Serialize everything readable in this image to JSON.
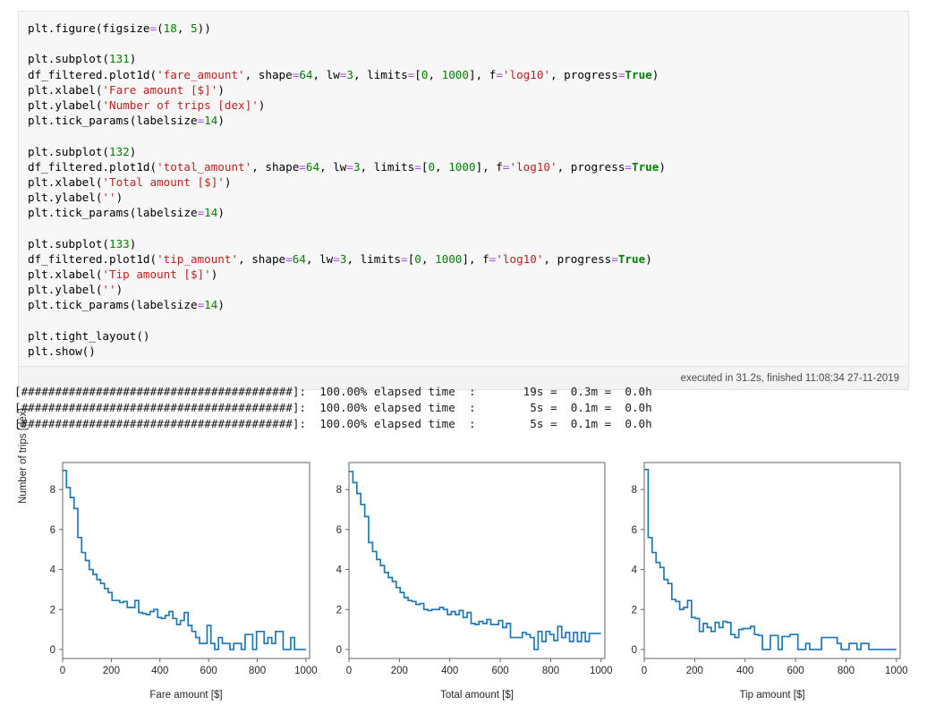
{
  "notebook": {
    "code_lines": [
      [
        {
          "t": "plain",
          "v": "plt.figure(figsize"
        },
        {
          "t": "op",
          "v": "="
        },
        {
          "t": "plain",
          "v": "("
        },
        {
          "t": "num",
          "v": "18"
        },
        {
          "t": "plain",
          "v": ", "
        },
        {
          "t": "num",
          "v": "5"
        },
        {
          "t": "plain",
          "v": "))"
        }
      ],
      [],
      [
        {
          "t": "plain",
          "v": "plt.subplot("
        },
        {
          "t": "num",
          "v": "131"
        },
        {
          "t": "plain",
          "v": ")"
        }
      ],
      [
        {
          "t": "plain",
          "v": "df_filtered.plot1d("
        },
        {
          "t": "str",
          "v": "'fare_amount'"
        },
        {
          "t": "plain",
          "v": ", shape"
        },
        {
          "t": "op",
          "v": "="
        },
        {
          "t": "num",
          "v": "64"
        },
        {
          "t": "plain",
          "v": ", lw"
        },
        {
          "t": "op",
          "v": "="
        },
        {
          "t": "num",
          "v": "3"
        },
        {
          "t": "plain",
          "v": ", limits"
        },
        {
          "t": "op",
          "v": "="
        },
        {
          "t": "plain",
          "v": "["
        },
        {
          "t": "num",
          "v": "0"
        },
        {
          "t": "plain",
          "v": ", "
        },
        {
          "t": "num",
          "v": "1000"
        },
        {
          "t": "plain",
          "v": "], f"
        },
        {
          "t": "op",
          "v": "="
        },
        {
          "t": "str",
          "v": "'log10'"
        },
        {
          "t": "plain",
          "v": ", progress"
        },
        {
          "t": "op",
          "v": "="
        },
        {
          "t": "kw",
          "v": "True"
        },
        {
          "t": "plain",
          "v": ")"
        }
      ],
      [
        {
          "t": "plain",
          "v": "plt.xlabel("
        },
        {
          "t": "str",
          "v": "'Fare amount [$]'"
        },
        {
          "t": "plain",
          "v": ")"
        }
      ],
      [
        {
          "t": "plain",
          "v": "plt.ylabel("
        },
        {
          "t": "str",
          "v": "'Number of trips [dex]'"
        },
        {
          "t": "plain",
          "v": ")"
        }
      ],
      [
        {
          "t": "plain",
          "v": "plt.tick_params(labelsize"
        },
        {
          "t": "op",
          "v": "="
        },
        {
          "t": "num",
          "v": "14"
        },
        {
          "t": "plain",
          "v": ")"
        }
      ],
      [],
      [
        {
          "t": "plain",
          "v": "plt.subplot("
        },
        {
          "t": "num",
          "v": "132"
        },
        {
          "t": "plain",
          "v": ")"
        }
      ],
      [
        {
          "t": "plain",
          "v": "df_filtered.plot1d("
        },
        {
          "t": "str",
          "v": "'total_amount'"
        },
        {
          "t": "plain",
          "v": ", shape"
        },
        {
          "t": "op",
          "v": "="
        },
        {
          "t": "num",
          "v": "64"
        },
        {
          "t": "plain",
          "v": ", lw"
        },
        {
          "t": "op",
          "v": "="
        },
        {
          "t": "num",
          "v": "3"
        },
        {
          "t": "plain",
          "v": ", limits"
        },
        {
          "t": "op",
          "v": "="
        },
        {
          "t": "plain",
          "v": "["
        },
        {
          "t": "num",
          "v": "0"
        },
        {
          "t": "plain",
          "v": ", "
        },
        {
          "t": "num",
          "v": "1000"
        },
        {
          "t": "plain",
          "v": "], f"
        },
        {
          "t": "op",
          "v": "="
        },
        {
          "t": "str",
          "v": "'log10'"
        },
        {
          "t": "plain",
          "v": ", progress"
        },
        {
          "t": "op",
          "v": "="
        },
        {
          "t": "kw",
          "v": "True"
        },
        {
          "t": "plain",
          "v": ")"
        }
      ],
      [
        {
          "t": "plain",
          "v": "plt.xlabel("
        },
        {
          "t": "str",
          "v": "'Total amount [$]'"
        },
        {
          "t": "plain",
          "v": ")"
        }
      ],
      [
        {
          "t": "plain",
          "v": "plt.ylabel("
        },
        {
          "t": "str",
          "v": "''"
        },
        {
          "t": "plain",
          "v": ")"
        }
      ],
      [
        {
          "t": "plain",
          "v": "plt.tick_params(labelsize"
        },
        {
          "t": "op",
          "v": "="
        },
        {
          "t": "num",
          "v": "14"
        },
        {
          "t": "plain",
          "v": ")"
        }
      ],
      [],
      [
        {
          "t": "plain",
          "v": "plt.subplot("
        },
        {
          "t": "num",
          "v": "133"
        },
        {
          "t": "plain",
          "v": ")"
        }
      ],
      [
        {
          "t": "plain",
          "v": "df_filtered.plot1d("
        },
        {
          "t": "str",
          "v": "'tip_amount'"
        },
        {
          "t": "plain",
          "v": ", shape"
        },
        {
          "t": "op",
          "v": "="
        },
        {
          "t": "num",
          "v": "64"
        },
        {
          "t": "plain",
          "v": ", lw"
        },
        {
          "t": "op",
          "v": "="
        },
        {
          "t": "num",
          "v": "3"
        },
        {
          "t": "plain",
          "v": ", limits"
        },
        {
          "t": "op",
          "v": "="
        },
        {
          "t": "plain",
          "v": "["
        },
        {
          "t": "num",
          "v": "0"
        },
        {
          "t": "plain",
          "v": ", "
        },
        {
          "t": "num",
          "v": "1000"
        },
        {
          "t": "plain",
          "v": "], f"
        },
        {
          "t": "op",
          "v": "="
        },
        {
          "t": "str",
          "v": "'log10'"
        },
        {
          "t": "plain",
          "v": ", progress"
        },
        {
          "t": "op",
          "v": "="
        },
        {
          "t": "kw",
          "v": "True"
        },
        {
          "t": "plain",
          "v": ")"
        }
      ],
      [
        {
          "t": "plain",
          "v": "plt.xlabel("
        },
        {
          "t": "str",
          "v": "'Tip amount [$]'"
        },
        {
          "t": "plain",
          "v": ")"
        }
      ],
      [
        {
          "t": "plain",
          "v": "plt.ylabel("
        },
        {
          "t": "str",
          "v": "''"
        },
        {
          "t": "plain",
          "v": ")"
        }
      ],
      [
        {
          "t": "plain",
          "v": "plt.tick_params(labelsize"
        },
        {
          "t": "op",
          "v": "="
        },
        {
          "t": "num",
          "v": "14"
        },
        {
          "t": "plain",
          "v": ")"
        }
      ],
      [],
      [
        {
          "t": "plain",
          "v": "plt.tight_layout()"
        }
      ],
      [
        {
          "t": "plain",
          "v": "plt.show()"
        }
      ]
    ],
    "execution_status": "executed in 31.2s, finished 11:08:34 27-11-2019"
  },
  "progress_output": {
    "lines": [
      "[########################################]:  100.00% elapsed time  :       19s =  0.3m =  0.0h",
      "[########################################]:  100.00% elapsed time  :        5s =  0.1m =  0.0h",
      "[########################################]:  100.00% elapsed time  :        5s =  0.1m =  0.0h"
    ]
  },
  "chart_data": [
    {
      "type": "line",
      "drawstyle": "steps-post",
      "title": "",
      "xlabel": "Fare amount [$]",
      "ylabel": "Number of trips [dex]",
      "xlim": [
        0,
        1015
      ],
      "ylim": [
        -0.45,
        9.35
      ],
      "xticks": [
        0,
        200,
        400,
        600,
        800,
        1000
      ],
      "yticks": [
        0,
        2,
        4,
        6,
        8
      ],
      "grid": false,
      "legend": null,
      "line_color": "#1f77b4",
      "bin_width": 15.625,
      "x": [
        0,
        15.6,
        31.3,
        46.9,
        62.5,
        78.1,
        93.8,
        109.4,
        125,
        140.6,
        156.3,
        171.9,
        187.5,
        203.1,
        218.8,
        234.4,
        250,
        265.6,
        281.3,
        296.9,
        312.5,
        328.1,
        343.8,
        359.4,
        375,
        390.6,
        406.3,
        421.9,
        437.5,
        453.1,
        468.8,
        484.4,
        500,
        515.6,
        531.3,
        546.9,
        562.5,
        578.1,
        593.8,
        609.4,
        625,
        640.6,
        656.3,
        671.9,
        687.5,
        703.1,
        718.8,
        734.4,
        750,
        765.6,
        781.3,
        796.9,
        812.5,
        828.1,
        843.8,
        859.4,
        875,
        890.6,
        906.3,
        921.9,
        937.5,
        953.1,
        968.8,
        984.4
      ],
      "values": [
        8.95,
        8.1,
        7.6,
        7.05,
        5.6,
        4.85,
        4.45,
        4.0,
        3.75,
        3.5,
        3.3,
        3.05,
        2.85,
        2.45,
        2.45,
        2.35,
        2.4,
        2.1,
        2.1,
        2.45,
        1.85,
        1.8,
        1.75,
        1.9,
        2.0,
        1.6,
        1.55,
        1.7,
        1.9,
        1.55,
        1.25,
        1.45,
        1.85,
        1.2,
        0.9,
        0.6,
        0.3,
        0.3,
        1.2,
        0.3,
        0.0,
        0.6,
        0.3,
        0.3,
        0.0,
        0.3,
        0.3,
        0.0,
        0.75,
        0.75,
        0.0,
        0.9,
        0.9,
        0.3,
        0.6,
        0.3,
        0.9,
        0.9,
        0.0,
        0.0,
        0.6,
        0.0,
        0.0,
        0.0
      ]
    },
    {
      "type": "line",
      "drawstyle": "steps-post",
      "title": "",
      "xlabel": "Total amount [$]",
      "ylabel": "",
      "xlim": [
        0,
        1015
      ],
      "ylim": [
        -0.45,
        9.35
      ],
      "xticks": [
        0,
        200,
        400,
        600,
        800,
        1000
      ],
      "yticks": [
        0,
        2,
        4,
        6,
        8
      ],
      "grid": false,
      "legend": null,
      "line_color": "#1f77b4",
      "bin_width": 15.625,
      "x": [
        0,
        15.6,
        31.3,
        46.9,
        62.5,
        78.1,
        93.8,
        109.4,
        125,
        140.6,
        156.3,
        171.9,
        187.5,
        203.1,
        218.8,
        234.4,
        250,
        265.6,
        281.3,
        296.9,
        312.5,
        328.1,
        343.8,
        359.4,
        375,
        390.6,
        406.3,
        421.9,
        437.5,
        453.1,
        468.8,
        484.4,
        500,
        515.6,
        531.3,
        546.9,
        562.5,
        578.1,
        593.8,
        609.4,
        625,
        640.6,
        656.3,
        671.9,
        687.5,
        703.1,
        718.8,
        734.4,
        750,
        765.6,
        781.3,
        796.9,
        812.5,
        828.1,
        843.8,
        859.4,
        875,
        890.6,
        906.3,
        921.9,
        937.5,
        953.1,
        968.8,
        984.4
      ],
      "values": [
        8.9,
        8.35,
        7.8,
        7.25,
        6.65,
        5.35,
        4.9,
        4.5,
        4.2,
        3.85,
        3.6,
        3.4,
        3.1,
        2.85,
        2.6,
        2.45,
        2.4,
        2.25,
        2.3,
        2.0,
        1.95,
        2.0,
        2.0,
        2.1,
        2.0,
        1.75,
        1.9,
        1.75,
        1.95,
        1.6,
        1.85,
        1.3,
        1.25,
        1.4,
        1.3,
        1.5,
        1.25,
        1.25,
        1.45,
        1.1,
        1.3,
        0.6,
        0.6,
        0.6,
        0.85,
        0.75,
        0.6,
        0.0,
        0.9,
        0.4,
        0.9,
        0.75,
        0.45,
        1.15,
        0.6,
        0.85,
        0.4,
        0.85,
        0.4,
        0.85,
        0.4,
        0.8,
        0.8,
        0.8
      ]
    },
    {
      "type": "line",
      "drawstyle": "steps-post",
      "title": "",
      "xlabel": "Tip amount [$]",
      "ylabel": "",
      "xlim": [
        0,
        1015
      ],
      "ylim": [
        -0.45,
        9.35
      ],
      "xticks": [
        0,
        200,
        400,
        600,
        800,
        1000
      ],
      "yticks": [
        0,
        2,
        4,
        6,
        8
      ],
      "grid": false,
      "legend": null,
      "line_color": "#1f77b4",
      "bin_width": 15.625,
      "x": [
        0,
        15.6,
        31.3,
        46.9,
        62.5,
        78.1,
        93.8,
        109.4,
        125,
        140.6,
        156.3,
        171.9,
        187.5,
        203.1,
        218.8,
        234.4,
        250,
        265.6,
        281.3,
        296.9,
        312.5,
        328.1,
        343.8,
        359.4,
        375,
        390.6,
        406.3,
        421.9,
        437.5,
        453.1,
        468.8,
        484.4,
        500,
        515.6,
        531.3,
        546.9,
        562.5,
        578.1,
        593.8,
        609.4,
        625,
        640.6,
        656.3,
        671.9,
        687.5,
        703.1,
        718.8,
        734.4,
        750,
        765.6,
        781.3,
        796.9,
        812.5,
        828.1,
        843.8,
        859.4,
        875,
        890.6,
        906.3,
        921.9,
        937.5,
        953.1,
        968.8,
        984.4
      ],
      "values": [
        9.0,
        5.6,
        4.85,
        4.35,
        4.1,
        3.5,
        3.3,
        2.5,
        2.4,
        2.0,
        2.1,
        2.45,
        1.6,
        1.55,
        0.9,
        1.3,
        1.1,
        0.9,
        1.35,
        1.1,
        1.4,
        1.35,
        0.75,
        0.6,
        1.0,
        1.05,
        1.05,
        1.15,
        0.75,
        0.7,
        0.0,
        0.0,
        0.7,
        0.7,
        0.0,
        0.65,
        0.65,
        0.75,
        0.75,
        0.0,
        0.0,
        0.3,
        0.0,
        0.0,
        0.0,
        0.6,
        0.6,
        0.6,
        0.6,
        0.3,
        0.0,
        0.0,
        0.3,
        0.3,
        0.0,
        0.3,
        0.3,
        0.0,
        0.0,
        0.0,
        0.0,
        0.0,
        0.0,
        0.0
      ]
    }
  ]
}
